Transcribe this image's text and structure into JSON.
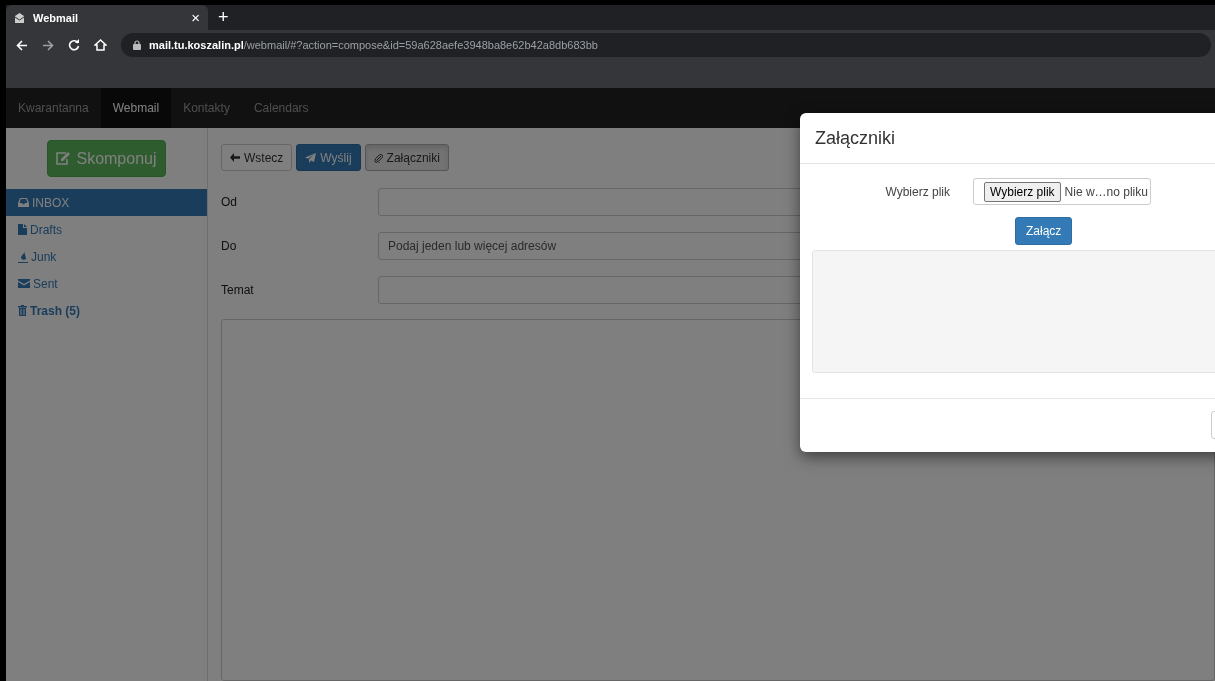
{
  "browser": {
    "tab": {
      "title": "Webmail",
      "close": "×"
    },
    "new_tab": "+",
    "url": {
      "host": "mail.tu.koszalin.pl",
      "path": "/webmail/#?action=compose&id=59a628aefe3948ba8e62b42a8db683bb"
    }
  },
  "nav": [
    {
      "label": "Kwarantanna",
      "selected": false
    },
    {
      "label": "Webmail",
      "selected": true
    },
    {
      "label": "Kontakty",
      "selected": false
    },
    {
      "label": "Calendars",
      "selected": false
    }
  ],
  "sidebar": {
    "compose_button": "Skomponuj",
    "folders": [
      {
        "label": "INBOX",
        "selected": true,
        "unread": false
      },
      {
        "label": "Drafts",
        "selected": false,
        "unread": false
      },
      {
        "label": "Junk",
        "selected": false,
        "unread": false
      },
      {
        "label": "Sent",
        "selected": false,
        "unread": false
      },
      {
        "label": "Trash (5)",
        "selected": false,
        "unread": true
      }
    ]
  },
  "toolbar": [
    {
      "label": "Wstecz",
      "kind": "back"
    },
    {
      "label": "Wyślij",
      "kind": "send"
    },
    {
      "label": "Załączniki",
      "kind": "attach"
    }
  ],
  "fields": [
    {
      "label": "Od"
    },
    {
      "label": "Do",
      "placeholder": "Podaj jeden lub więcej adresów"
    },
    {
      "label": "Temat"
    }
  ],
  "modal": {
    "title": "Załączniki",
    "file_label": "Wybierz plik",
    "file_button": "Wybierz plik",
    "file_status": "Nie w…no pliku",
    "attach_button": "Załącz"
  }
}
